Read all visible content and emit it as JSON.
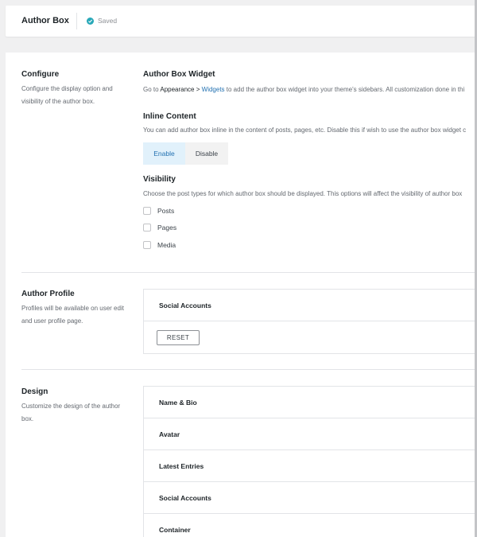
{
  "header": {
    "title": "Author Box",
    "status": "Saved"
  },
  "configure": {
    "title": "Configure",
    "description_lines": [
      "Configure the display option and",
      "visibility of the author box."
    ],
    "widget": {
      "title": "Author Box Widget",
      "desc_prefix": "Go to ",
      "desc_strong": "Appearance",
      "desc_arrow": " > ",
      "desc_link": "Widgets",
      "desc_suffix": " to add the author box widget into your theme's sidebars. All customization done in thi"
    },
    "inline": {
      "title": "Inline Content",
      "desc": "You can add author box inline in the content of posts, pages, etc. Disable this if wish to use the author box widget c",
      "enable_label": "Enable",
      "disable_label": "Disable",
      "selected": "Enable"
    },
    "visibility": {
      "title": "Visibility",
      "desc": "Choose the post types for which author box should be displayed. This options will affect the visibility of author box",
      "options": [
        {
          "label": "Posts",
          "checked": false
        },
        {
          "label": "Pages",
          "checked": false
        },
        {
          "label": "Media",
          "checked": false
        }
      ]
    }
  },
  "author_profile": {
    "title": "Author Profile",
    "description_lines": [
      "Profiles will be available on user edit",
      "and user profile page."
    ],
    "rows": [
      "Social Accounts"
    ],
    "reset_label": "RESET"
  },
  "design": {
    "title": "Design",
    "description_lines": [
      "Customize the design of the author",
      "box."
    ],
    "rows": [
      "Name & Bio",
      "Avatar",
      "Latest Entries",
      "Social Accounts",
      "Container"
    ]
  },
  "colors": {
    "accent": "#2271b1",
    "saved_check": "#28a8b8",
    "enable_bg": "#e1f1fb"
  }
}
